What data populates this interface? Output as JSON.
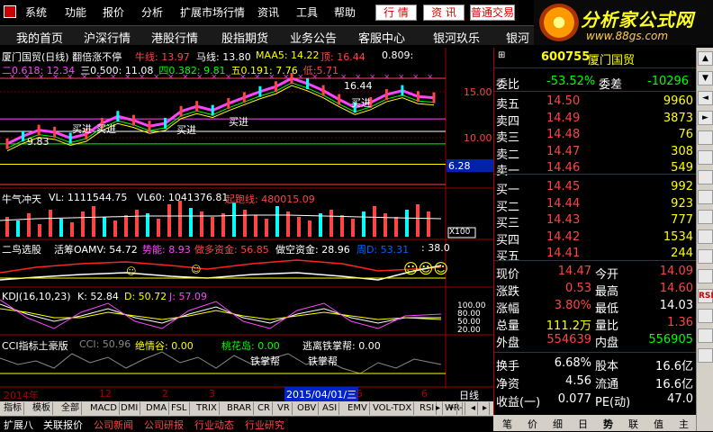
{
  "menu": {
    "items": [
      "系统",
      "功能",
      "报价",
      "分析",
      "扩展市场行情",
      "资讯",
      "工具",
      "帮助"
    ],
    "buttons": [
      "行 情",
      "资 讯",
      "普通交易"
    ]
  },
  "banner": {
    "title": "分析家公式网",
    "url": "www.88gs.com"
  },
  "nav": {
    "items": [
      "我的首页",
      "沪深行情",
      "港股行情",
      "股指期货",
      "业务公告",
      "客服中心",
      "银河玖乐",
      "银河"
    ]
  },
  "main_chart": {
    "title": "厦门国贸(日线) 翻倍涨不停",
    "niu": "牛线: 13.97",
    "ma": "马线: 13.80",
    "maa5": "MAA5: 14.22",
    "ding": "顶: 16.44",
    "ding_right": "0.809:",
    "row2": [
      {
        "label": "二",
        "value": "0.618: 12.34",
        "color": "#ff44ff"
      },
      {
        "label": "三",
        "value": "0.500: 11.08",
        "color": "#ffffff"
      },
      {
        "label": "四",
        "value": "0.382: 9.81",
        "color": "#00ff00"
      },
      {
        "label": "五",
        "value": "0.191: 7.76",
        "color": "#ffff00"
      },
      {
        "label": "低:",
        "value": "5.71",
        "color": "#ff4444"
      }
    ],
    "peak_label": "16.44",
    "low_label": "9.83",
    "price_ticks": [
      "15.00",
      "10.00"
    ],
    "price_tag": "6.28",
    "buy_labels": [
      "买进",
      "买进",
      "买进",
      "买进",
      "买进"
    ]
  },
  "volume_panel": {
    "title": "牛气冲天",
    "vl": "VL: 1111544.75",
    "vl60": "VL60: 1041376.81",
    "qipao": "起跑线: 480015.09",
    "unit": "X100"
  },
  "fund_panel": {
    "title": "二鸟选股",
    "oamv": "活筹OAMV: 54.72",
    "shi": "势能: 8.93",
    "duo": "做多资金: 56.85",
    "kong": "做空资金: 28.96",
    "zhou": "周D: 53.31",
    "val38": ": 38.0"
  },
  "kdj_panel": {
    "title": "KDJ(16,10,23)",
    "k": "K: 52.84",
    "d": "D: 50.72",
    "j": "J: 57.09",
    "ticks": [
      "100.00",
      "80.00",
      "50.00",
      "20.00"
    ]
  },
  "cci_panel": {
    "title": "CCI指标土豪版",
    "cci": "CCI: 50.96",
    "jueqing": "绝情谷: 0.00",
    "taohua": "桃花岛: 0.00",
    "taoli": "逃离铁掌帮: 0.00",
    "tiezhang": [
      "铁掌帮",
      "铁掌帮"
    ]
  },
  "date_axis": {
    "year": "2014年",
    "months": [
      "12",
      "2",
      "3",
      "5",
      "6"
    ],
    "highlight": "2015/04/01/三",
    "period": "日线"
  },
  "indicator_tabs": [
    "指标",
    "模板",
    "全部",
    "MACD",
    "DMI",
    "DMA",
    "FSL",
    "TRIX",
    "BRAR",
    "CR",
    "VR",
    "OBV",
    "ASI",
    "EMV",
    "VOL-TDX",
    "RSI",
    "WR"
  ],
  "bottom_tabs": [
    "扩展八",
    "关联报价",
    "公司新闻",
    "公司研报",
    "行业动态",
    "行业研究"
  ],
  "quote": {
    "code": "600755",
    "name": "厦门国贸",
    "weibi_label": "委比",
    "weibi": "-53.52%",
    "weicha_label": "委差",
    "weicha": "-10296",
    "sells": [
      {
        "label": "卖五",
        "price": "14.50",
        "vol": "9960"
      },
      {
        "label": "卖四",
        "price": "14.49",
        "vol": "3873"
      },
      {
        "label": "卖三",
        "price": "14.48",
        "vol": "76"
      },
      {
        "label": "卖二",
        "price": "14.47",
        "vol": "308"
      },
      {
        "label": "卖一",
        "price": "14.46",
        "vol": "549"
      }
    ],
    "buys": [
      {
        "label": "买一",
        "price": "14.45",
        "vol": "992"
      },
      {
        "label": "买二",
        "price": "14.44",
        "vol": "923"
      },
      {
        "label": "买三",
        "price": "14.43",
        "vol": "777"
      },
      {
        "label": "买四",
        "price": "14.42",
        "vol": "1534"
      },
      {
        "label": "买五",
        "price": "14.41",
        "vol": "244"
      }
    ],
    "stats": [
      {
        "l1": "现价",
        "v1": "14.47",
        "l2": "今开",
        "v2": "14.09",
        "c1": "#ff4444",
        "c2": "#ff4444"
      },
      {
        "l1": "涨跌",
        "v1": "0.53",
        "l2": "最高",
        "v2": "14.60",
        "c1": "#ff4444",
        "c2": "#ff4444"
      },
      {
        "l1": "涨幅",
        "v1": "3.80%",
        "l2": "最低",
        "v2": "14.03",
        "c1": "#ff4444",
        "c2": "#ffffff"
      },
      {
        "l1": "总量",
        "v1": "111.2万",
        "l2": "量比",
        "v2": "1.36",
        "c1": "#ffff00",
        "c2": "#ff4444"
      },
      {
        "l1": "外盘",
        "v1": "554639",
        "l2": "内盘",
        "v2": "556905",
        "c1": "#ff4444",
        "c2": "#00ff00"
      }
    ],
    "stats2": [
      {
        "l1": "换手",
        "v1": "6.68%",
        "l2": "股本",
        "v2": "16.6亿"
      },
      {
        "l1": "净资",
        "v1": "4.56",
        "l2": "流通",
        "v2": "16.6亿"
      },
      {
        "l1": "收益(一)",
        "v1": "0.077",
        "l2": "PE(动)",
        "v2": "47.0"
      }
    ]
  },
  "right_tabs": [
    "笔",
    "价",
    "细",
    "日",
    "势",
    "联",
    "值",
    "主"
  ],
  "scrollbar_buttons": [
    "▲",
    "▼",
    "◄",
    "►",
    "",
    "",
    "",
    "",
    "",
    "",
    "",
    "",
    "RSI",
    "",
    "",
    ""
  ],
  "colors": {
    "up": "#ff4444",
    "down": "#00ff00",
    "accent": "#ffff00",
    "grid": "#a00000"
  },
  "chart_data": {
    "type": "line",
    "title": "厦门国贸(日线) 翻倍涨不停",
    "xlabel": "",
    "ylabel": "",
    "ylim": [
      5.71,
      16.44
    ],
    "levels": [
      {
        "name": "顶",
        "value": 16.44
      },
      {
        "name": "二",
        "value": 12.34
      },
      {
        "name": "三",
        "value": 11.08
      },
      {
        "name": "四",
        "value": 9.81
      },
      {
        "name": "五",
        "value": 7.76
      },
      {
        "name": "低",
        "value": 5.71
      }
    ],
    "series": [
      {
        "values": [
          9.83,
          10.6,
          11.2,
          11.0,
          10.4,
          10.8,
          11.9,
          12.6,
          12.2,
          11.6,
          11.9,
          13.1,
          13.6,
          13.2,
          13.9,
          14.5,
          15.1,
          15.6,
          16.44,
          15.9,
          15.2,
          14.3,
          13.5,
          14.0,
          14.8,
          15.2,
          14.6,
          14.47
        ]
      }
    ]
  }
}
